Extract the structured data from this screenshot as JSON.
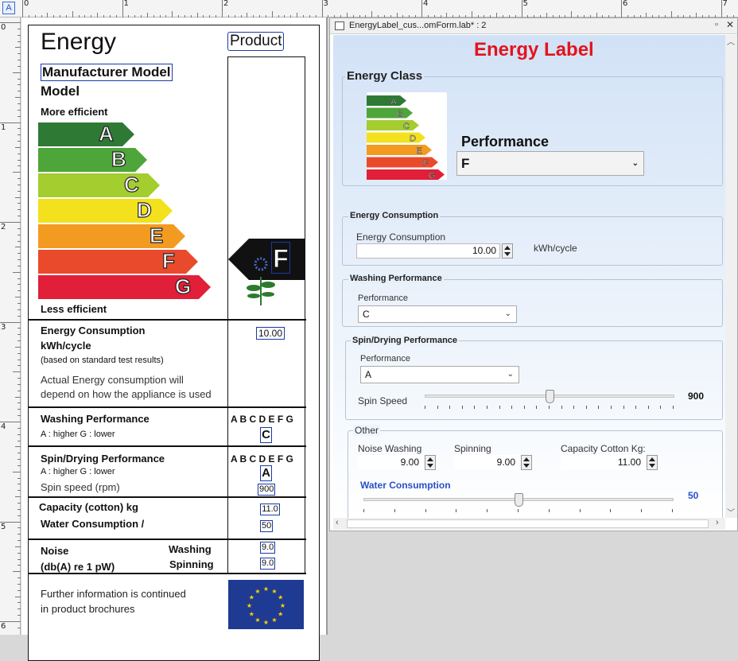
{
  "ruler": {
    "h_numbers": [
      "0",
      "1",
      "2",
      "3",
      "4",
      "5",
      "6",
      "7"
    ],
    "v_numbers": [
      "0",
      "1",
      "2",
      "3",
      "4",
      "5",
      "6"
    ]
  },
  "design": {
    "energy_title": "Energy",
    "product_header": "Product",
    "manufacturer_model": "Manufacturer Model",
    "model": "Model",
    "more_efficient": "More efficient",
    "less_efficient": "Less efficient",
    "classes": [
      "A",
      "B",
      "C",
      "D",
      "E",
      "F",
      "G"
    ],
    "class_colors": [
      "#2e7a35",
      "#4ea53a",
      "#a4cd2f",
      "#f4e11e",
      "#f39a21",
      "#ea4a2c",
      "#e11f38"
    ],
    "selected_class": "F",
    "consumption_title": "Energy Consumption",
    "consumption_unit": "kWh/cycle",
    "consumption_note": "(based on standard test results)",
    "consumption_note2": "Actual Energy consumption will",
    "consumption_note3": "depend on how the appliance is used",
    "consumption_value": "10.00",
    "washing_title": "Washing Performance",
    "washing_scale": "A : higher   G : lower",
    "letters_row": "A B C D E F G",
    "washing_value": "C",
    "spin_title": "Spin/Drying Performance",
    "spin_scale": "A : higher   G : lower",
    "spin_speed_label": "Spin speed (rpm)",
    "spin_value": "A",
    "spin_speed_value": "900",
    "capacity_label": "Capacity (cotton) kg",
    "water_label": "Water Consumption /",
    "capacity_value": "11.0",
    "water_value": "50",
    "noise_label": "Noise",
    "noise_unit": "(db(A)  re  1  pW)",
    "washing_word": "Washing",
    "spinning_word": "Spinning",
    "noise_washing_value": "9.0",
    "noise_spinning_value": "9.0",
    "further_info1": "Further information is continued",
    "further_info2": "in product brochures"
  },
  "window": {
    "title": "EnergyLabel_cus...omForm.lab* : 2",
    "heading": "Energy Label",
    "heading_color": "#e3141d",
    "energy_class_group": "Energy Class",
    "performance_label": "Performance",
    "performance_value": "F",
    "consumption_group": "Energy Consumption",
    "consumption_field_label": "Energy Consumption",
    "consumption_field_value": "10.00",
    "consumption_unit": "kWh/cycle",
    "washing_group": "Washing Performance",
    "washing_field_label": "Performance",
    "washing_field_value": "C",
    "spin_group": "Spin/Drying Performance",
    "spin_field_label": "Performance",
    "spin_field_value": "A",
    "spin_speed_label": "Spin Speed",
    "spin_speed_value": "900",
    "spin_speed_fraction": 0.5,
    "other_group": "Other",
    "noise_washing_label": "Noise Washing",
    "noise_washing_value": "9.00",
    "spinning_label": "Spinning",
    "spinning_value": "9.00",
    "capacity_label": "Capacity Cotton Kg:",
    "capacity_value": "11.00",
    "water_label": "Water Consumption",
    "water_value": "50",
    "water_fraction": 0.5,
    "accent_blue": "#2a4fc8"
  }
}
